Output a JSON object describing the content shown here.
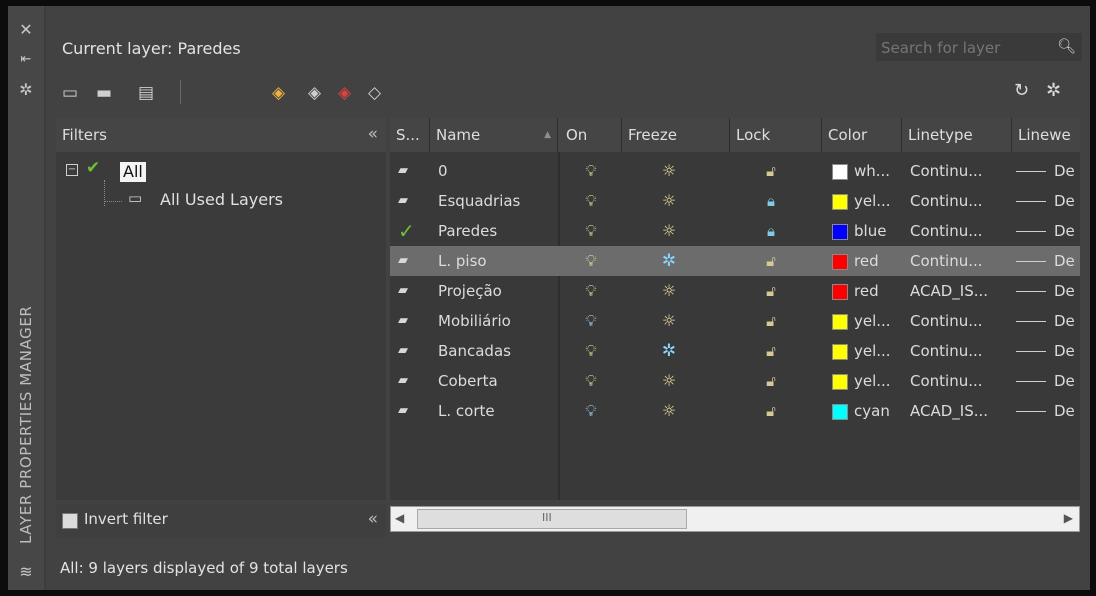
{
  "palette": {
    "white": "#ffffff",
    "yellow": "#ffff00",
    "blue": "#0000ff",
    "red": "#ff0000",
    "cyan": "#00ffff"
  },
  "sidebar": {
    "title": "LAYER PROPERTIES MANAGER",
    "icons": [
      "close-icon",
      "pin-icon",
      "settings-icon",
      "layers-icon"
    ]
  },
  "header": {
    "current_layer": "Current layer: Paredes",
    "search_placeholder": "Search for layer"
  },
  "toolbar": {
    "icons": [
      "new-property-filter-icon",
      "new-group-filter-icon",
      "layer-states-manager-icon",
      "new-layer-icon",
      "new-layer-vp-frozen-icon",
      "delete-layer-icon",
      "set-current-icon",
      "refresh-icon",
      "settings-icon"
    ]
  },
  "filters": {
    "header": "Filters",
    "tree": {
      "root": "All",
      "child": "All Used Layers"
    },
    "invert_filter": "Invert filter"
  },
  "table": {
    "columns": [
      "S...",
      "Name",
      "On",
      "Freeze",
      "Lock",
      "Color",
      "Linetype",
      "Linewe"
    ],
    "rows": [
      {
        "name": "0",
        "on": true,
        "frozen": false,
        "locked": false,
        "color": "wh...",
        "color_hex": "#ffffff",
        "linetype": "Continu...",
        "lw": "De",
        "status": "layer"
      },
      {
        "name": "Esquadrias",
        "on": true,
        "frozen": false,
        "locked": true,
        "color": "yel...",
        "color_hex": "#ffff00",
        "linetype": "Continu...",
        "lw": "De",
        "status": "layer"
      },
      {
        "name": "Paredes",
        "on": true,
        "frozen": false,
        "locked": true,
        "color": "blue",
        "color_hex": "#0000ff",
        "linetype": "Continu...",
        "lw": "De",
        "status": "current"
      },
      {
        "name": "L. piso",
        "on": true,
        "frozen": true,
        "locked": false,
        "color": "red",
        "color_hex": "#ff0000",
        "linetype": "Continu...",
        "lw": "De",
        "status": "layer",
        "selected": true
      },
      {
        "name": "Projeção",
        "on": true,
        "frozen": false,
        "locked": false,
        "color": "red",
        "color_hex": "#ff0000",
        "linetype": "ACAD_IS...",
        "lw": "De",
        "status": "layer"
      },
      {
        "name": "Mobiliário",
        "on": false,
        "frozen": false,
        "locked": false,
        "color": "yel...",
        "color_hex": "#ffff00",
        "linetype": "Continu...",
        "lw": "De",
        "status": "layer"
      },
      {
        "name": "Bancadas",
        "on": true,
        "frozen": true,
        "locked": false,
        "color": "yel...",
        "color_hex": "#ffff00",
        "linetype": "Continu...",
        "lw": "De",
        "status": "layer"
      },
      {
        "name": "Coberta",
        "on": true,
        "frozen": false,
        "locked": false,
        "color": "yel...",
        "color_hex": "#ffff00",
        "linetype": "Continu...",
        "lw": "De",
        "status": "layer"
      },
      {
        "name": "L. corte",
        "on": false,
        "frozen": false,
        "locked": false,
        "color": "cyan",
        "color_hex": "#00ffff",
        "linetype": "ACAD_IS...",
        "lw": "De",
        "status": "layer"
      }
    ]
  },
  "scrollbar": {
    "thumb_label": "III"
  },
  "status_bar": "All: 9 layers displayed of 9 total layers"
}
